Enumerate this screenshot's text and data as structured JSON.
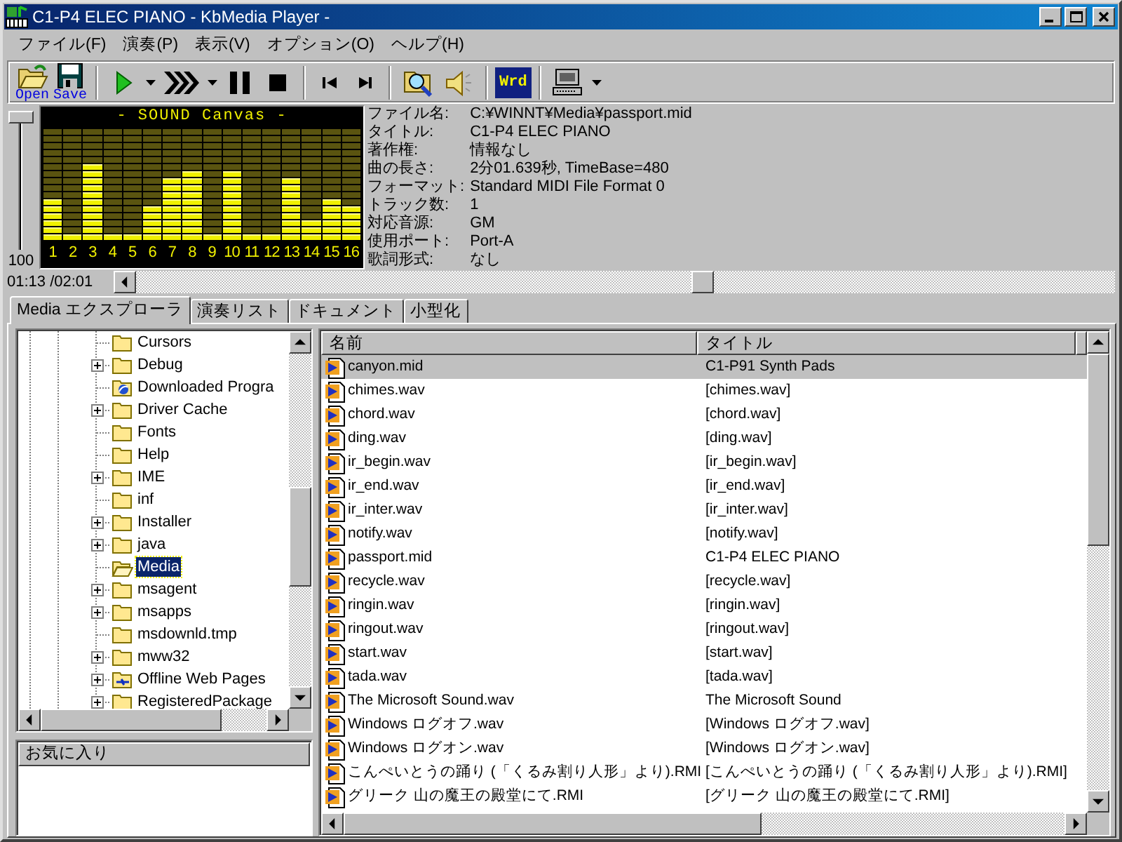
{
  "window": {
    "title": "C1-P4 ELEC PIANO - KbMedia Player -"
  },
  "menu": [
    "ファイル(F)",
    "演奏(P)",
    "表示(V)",
    "オプション(O)",
    "ヘルプ(H)"
  ],
  "toolbar": [
    {
      "kind": "open",
      "label": "Open"
    },
    {
      "kind": "save",
      "label": "Save"
    },
    {
      "kind": "separator"
    },
    {
      "kind": "play"
    },
    {
      "kind": "dropdown"
    },
    {
      "kind": "forward"
    },
    {
      "kind": "dropdown"
    },
    {
      "kind": "pause"
    },
    {
      "kind": "stop"
    },
    {
      "kind": "separator"
    },
    {
      "kind": "prev"
    },
    {
      "kind": "next"
    },
    {
      "kind": "separator"
    },
    {
      "kind": "find"
    },
    {
      "kind": "speaker"
    },
    {
      "kind": "separator"
    },
    {
      "kind": "wrd",
      "label": "Wrd"
    },
    {
      "kind": "separator"
    },
    {
      "kind": "pc"
    },
    {
      "kind": "dropdown"
    }
  ],
  "player": {
    "volume": {
      "level": 1,
      "reading": "100"
    },
    "display": {
      "title": "- SOUND Canvas -",
      "channels": [
        {
          "label": "1",
          "level": 0.375
        },
        {
          "label": "2",
          "level": 0.0625
        },
        {
          "label": "3",
          "level": 0.6875
        },
        {
          "label": "4",
          "level": 0.0625
        },
        {
          "label": "5",
          "level": 0.0625
        },
        {
          "label": "6",
          "level": 0.3125
        },
        {
          "label": "7",
          "level": 0.5625
        },
        {
          "label": "8",
          "level": 0.625
        },
        {
          "label": "9",
          "level": 0.0625
        },
        {
          "label": "10",
          "level": 0.625
        },
        {
          "label": "11",
          "level": 0.0625
        },
        {
          "label": "12",
          "level": 0.0625
        },
        {
          "label": "13",
          "level": 0.5625
        },
        {
          "label": "14",
          "level": 0.1875
        },
        {
          "label": "15",
          "level": 0.375
        },
        {
          "label": "16",
          "level": 0.3125
        }
      ]
    },
    "info": [
      {
        "label": "ファイル名:",
        "value": "C:¥WINNT¥Media¥passport.mid"
      },
      {
        "label": "タイトル:",
        "value": "C1-P4 ELEC PIANO"
      },
      {
        "label": "著作権:",
        "value": "情報なし"
      },
      {
        "label": "曲の長さ:",
        "value": "2分01.639秒, TimeBase=480"
      },
      {
        "label": "フォーマット:",
        "value": "Standard MIDI File Format 0"
      },
      {
        "label": "トラック数:",
        "value": "1"
      },
      {
        "label": "対応音源:",
        "value": "GM"
      },
      {
        "label": "使用ポート:",
        "value": "Port-A"
      },
      {
        "label": "歌詞形式:",
        "value": "なし"
      }
    ],
    "time": "01:13 /02:01",
    "seek": {
      "level": 0.58
    }
  },
  "tabs": [
    {
      "label": "Media エクスプローラ",
      "selected": true
    },
    {
      "label": "演奏リスト",
      "selected": false
    },
    {
      "label": "ドキュメント",
      "selected": false
    },
    {
      "label": "小型化",
      "selected": false
    }
  ],
  "tree": [
    {
      "label": "Cursors",
      "kind": "folder",
      "expandable": false,
      "selected": false
    },
    {
      "label": "Debug",
      "kind": "folder",
      "expandable": true,
      "selected": false
    },
    {
      "label": "Downloaded Progra",
      "kind": "web",
      "expandable": false,
      "selected": false
    },
    {
      "label": "Driver Cache",
      "kind": "folder",
      "expandable": true,
      "selected": false
    },
    {
      "label": "Fonts",
      "kind": "folder",
      "expandable": false,
      "selected": false
    },
    {
      "label": "Help",
      "kind": "folder",
      "expandable": false,
      "selected": false
    },
    {
      "label": "IME",
      "kind": "folder",
      "expandable": true,
      "selected": false
    },
    {
      "label": "inf",
      "kind": "folder",
      "expandable": false,
      "selected": false
    },
    {
      "label": "Installer",
      "kind": "folder",
      "expandable": true,
      "selected": false
    },
    {
      "label": "java",
      "kind": "folder",
      "expandable": true,
      "selected": false
    },
    {
      "label": "Media",
      "kind": "folder",
      "expandable": false,
      "selected": true
    },
    {
      "label": "msagent",
      "kind": "folder",
      "expandable": true,
      "selected": false
    },
    {
      "label": "msapps",
      "kind": "folder",
      "expandable": true,
      "selected": false
    },
    {
      "label": "msdownld.tmp",
      "kind": "folder",
      "expandable": false,
      "selected": false
    },
    {
      "label": "mww32",
      "kind": "folder",
      "expandable": true,
      "selected": false
    },
    {
      "label": "Offline Web Pages",
      "kind": "sync",
      "expandable": true,
      "selected": false
    },
    {
      "label": "RegisteredPackage",
      "kind": "folder",
      "expandable": true,
      "selected": false
    }
  ],
  "favorites": {
    "title": "お気に入り"
  },
  "file_list": {
    "columns": [
      "名前",
      "タイトル"
    ],
    "rows": [
      {
        "name": "canyon.mid",
        "title": "C1-P91 Synth Pads",
        "selected": true
      },
      {
        "name": "chimes.wav",
        "title": "[chimes.wav]",
        "selected": false
      },
      {
        "name": "chord.wav",
        "title": "[chord.wav]",
        "selected": false
      },
      {
        "name": "ding.wav",
        "title": "[ding.wav]",
        "selected": false
      },
      {
        "name": "ir_begin.wav",
        "title": "[ir_begin.wav]",
        "selected": false
      },
      {
        "name": "ir_end.wav",
        "title": "[ir_end.wav]",
        "selected": false
      },
      {
        "name": "ir_inter.wav",
        "title": "[ir_inter.wav]",
        "selected": false
      },
      {
        "name": "notify.wav",
        "title": "[notify.wav]",
        "selected": false
      },
      {
        "name": "passport.mid",
        "title": "C1-P4 ELEC PIANO",
        "selected": false
      },
      {
        "name": "recycle.wav",
        "title": "[recycle.wav]",
        "selected": false
      },
      {
        "name": "ringin.wav",
        "title": "[ringin.wav]",
        "selected": false
      },
      {
        "name": "ringout.wav",
        "title": "[ringout.wav]",
        "selected": false
      },
      {
        "name": "start.wav",
        "title": "[start.wav]",
        "selected": false
      },
      {
        "name": "tada.wav",
        "title": "[tada.wav]",
        "selected": false
      },
      {
        "name": "The Microsoft Sound.wav",
        "title": "The Microsoft Sound",
        "selected": false
      },
      {
        "name": "Windows ログオフ.wav",
        "title": "[Windows ログオフ.wav]",
        "selected": false
      },
      {
        "name": "Windows ログオン.wav",
        "title": "[Windows ログオン.wav]",
        "selected": false
      },
      {
        "name": "こんぺいとうの踊り (「くるみ割り人形」より).RMI",
        "title": "[こんぺいとうの踊り (「くるみ割り人形」より).RMI]",
        "selected": false
      },
      {
        "name": "グリーク 山の魔王の殿堂にて.RMI",
        "title": "[グリーク 山の魔王の殿堂にて.RMI]",
        "selected": false
      }
    ]
  }
}
